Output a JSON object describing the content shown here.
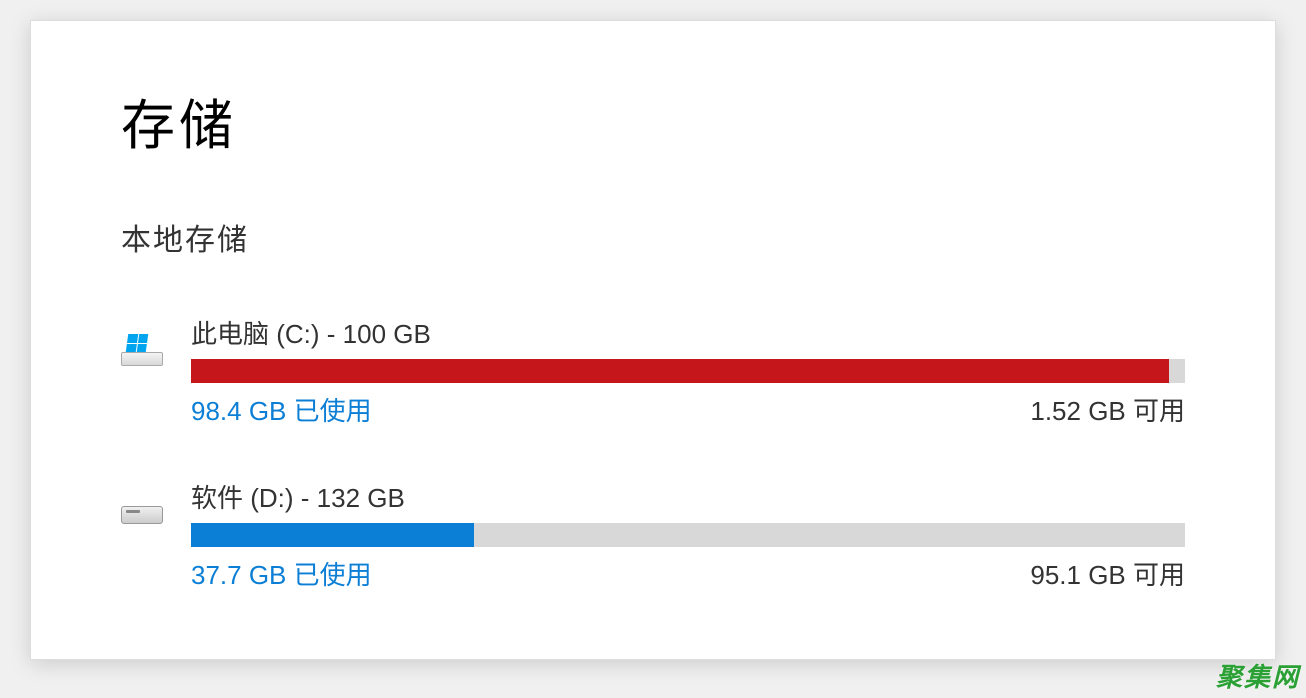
{
  "page_title": "存储",
  "section_title": "本地存储",
  "drives": [
    {
      "label": "此电脑 (C:) - 100 GB",
      "used_text": "98.4 GB 已使用",
      "free_text": "1.52 GB 可用",
      "fill_percent": 98.4,
      "fill_color": "fill-red",
      "icon": "system"
    },
    {
      "label": "软件 (D:) - 132 GB",
      "used_text": "37.7 GB 已使用",
      "free_text": "95.1 GB 可用",
      "fill_percent": 28.5,
      "fill_color": "fill-blue",
      "icon": "other"
    }
  ],
  "watermark": "聚集网"
}
